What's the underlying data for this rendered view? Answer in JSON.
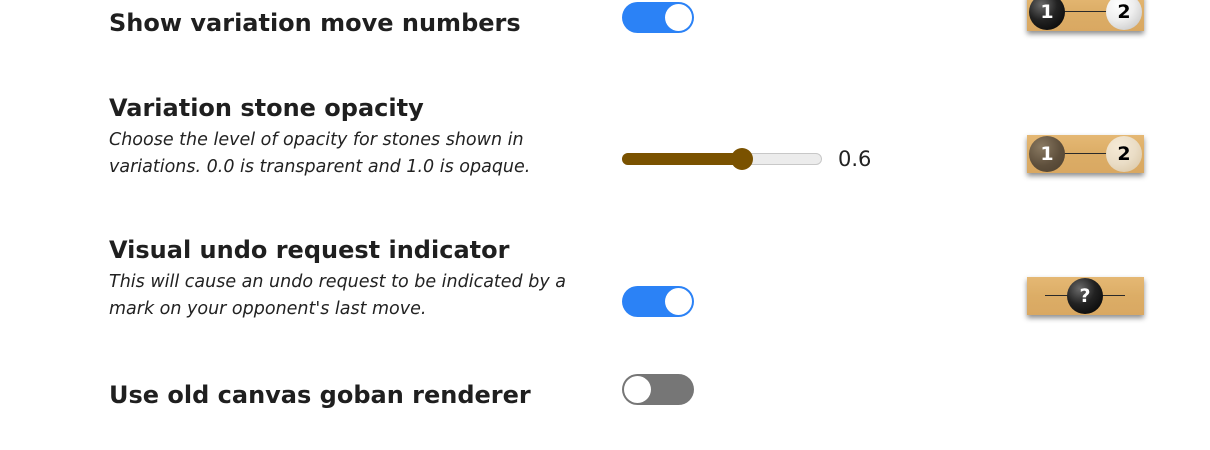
{
  "settings": {
    "variation_numbers": {
      "title": "Show variation move numbers",
      "toggle_on": true,
      "preview": {
        "stone1": "1",
        "stone2": "2"
      }
    },
    "variation_opacity": {
      "title": "Variation stone opacity",
      "description": "Choose the level of opacity for stones shown in variations. 0.0 is transparent and 1.0 is opaque.",
      "value": 0.6,
      "value_label": "0.6",
      "preview": {
        "stone1": "1",
        "stone2": "2"
      }
    },
    "visual_undo": {
      "title": "Visual undo request indicator",
      "description": "This will cause an undo request to be indicated by a mark on your opponent's last move.",
      "toggle_on": true,
      "preview": {
        "mark": "?"
      }
    },
    "old_canvas": {
      "title": "Use old canvas goban renderer",
      "toggle_on": false
    }
  },
  "colors": {
    "toggle_on": "#2b82f6",
    "toggle_off": "#767676",
    "slider_fill": "#7a5200",
    "board_wood": "#dcad66"
  }
}
